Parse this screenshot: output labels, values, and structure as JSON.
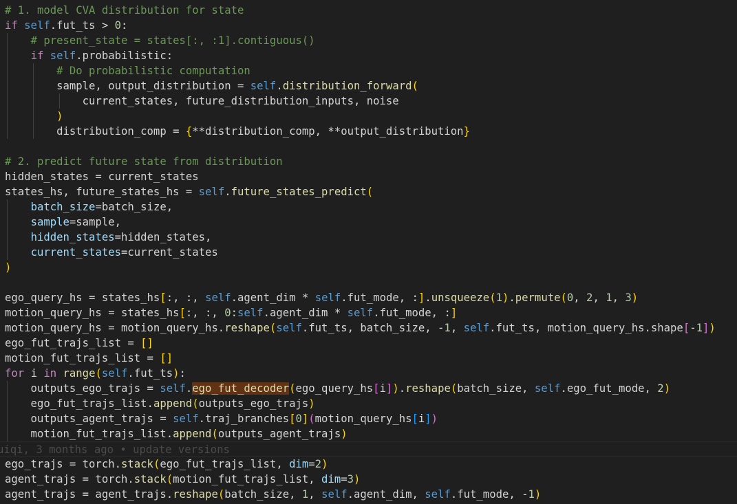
{
  "blame": "uiqi, 3 months ago • update versions",
  "lines": [
    [
      [
        "c",
        "# 1. model CVA distribution for state"
      ]
    ],
    [
      [
        "k",
        "if "
      ],
      [
        "s",
        "self"
      ],
      [
        "v",
        ".fut_ts > "
      ],
      [
        "n",
        "0"
      ],
      [
        "v",
        ":"
      ]
    ],
    [
      [
        "v",
        "    "
      ],
      [
        "c",
        "# present_state = states[:, :1].contiguous()"
      ]
    ],
    [
      [
        "v",
        "    "
      ],
      [
        "k",
        "if "
      ],
      [
        "s",
        "self"
      ],
      [
        "v",
        ".probabilistic:"
      ]
    ],
    [
      [
        "v",
        "        "
      ],
      [
        "c",
        "# Do probabilistic computation"
      ]
    ],
    [
      [
        "v",
        "        sample, output_distribution = "
      ],
      [
        "s",
        "self"
      ],
      [
        "v",
        "."
      ],
      [
        "f",
        "distribution_forward"
      ],
      [
        "b",
        "("
      ]
    ],
    [
      [
        "v",
        "            current_states, future_distribution_inputs, noise"
      ]
    ],
    [
      [
        "v",
        "        "
      ],
      [
        "b",
        ")"
      ]
    ],
    [
      [
        "v",
        "        distribution_comp = "
      ],
      [
        "b",
        "{"
      ],
      [
        "v",
        "**distribution_comp, **output_distribution"
      ],
      [
        "b",
        "}"
      ]
    ],
    [],
    [
      [
        "c",
        "# 2. predict future state from distribution"
      ]
    ],
    [
      [
        "v",
        "hidden_states = current_states"
      ]
    ],
    [
      [
        "v",
        "states_hs, future_states_hs = "
      ],
      [
        "s",
        "self"
      ],
      [
        "v",
        "."
      ],
      [
        "f",
        "future_states_predict"
      ],
      [
        "b",
        "("
      ]
    ],
    [
      [
        "v",
        "    "
      ],
      [
        "p",
        "batch_size"
      ],
      [
        "v",
        "=batch_size,"
      ]
    ],
    [
      [
        "v",
        "    "
      ],
      [
        "p",
        "sample"
      ],
      [
        "v",
        "=sample,"
      ]
    ],
    [
      [
        "v",
        "    "
      ],
      [
        "p",
        "hidden_states"
      ],
      [
        "v",
        "=hidden_states,"
      ]
    ],
    [
      [
        "v",
        "    "
      ],
      [
        "p",
        "current_states"
      ],
      [
        "v",
        "=current_states"
      ]
    ],
    [
      [
        "b",
        ")"
      ]
    ],
    [],
    [
      [
        "v",
        "ego_query_hs = states_hs"
      ],
      [
        "b",
        "["
      ],
      [
        "v",
        ":, :, "
      ],
      [
        "s",
        "self"
      ],
      [
        "v",
        ".agent_dim * "
      ],
      [
        "s",
        "self"
      ],
      [
        "v",
        ".fut_mode, :"
      ],
      [
        "b",
        "]"
      ],
      [
        "v",
        "."
      ],
      [
        "f",
        "unsqueeze"
      ],
      [
        "b",
        "("
      ],
      [
        "n",
        "1"
      ],
      [
        "b",
        ")"
      ],
      [
        "v",
        "."
      ],
      [
        "f",
        "permute"
      ],
      [
        "b",
        "("
      ],
      [
        "n",
        "0"
      ],
      [
        "v",
        ", "
      ],
      [
        "n",
        "2"
      ],
      [
        "v",
        ", "
      ],
      [
        "n",
        "1"
      ],
      [
        "v",
        ", "
      ],
      [
        "n",
        "3"
      ],
      [
        "b",
        ")"
      ]
    ],
    [
      [
        "v",
        "motion_query_hs = states_hs"
      ],
      [
        "b",
        "["
      ],
      [
        "v",
        ":, :, "
      ],
      [
        "n",
        "0"
      ],
      [
        "v",
        ":"
      ],
      [
        "s",
        "self"
      ],
      [
        "v",
        ".agent_dim * "
      ],
      [
        "s",
        "self"
      ],
      [
        "v",
        ".fut_mode, :"
      ],
      [
        "b",
        "]"
      ]
    ],
    [
      [
        "v",
        "motion_query_hs = motion_query_hs."
      ],
      [
        "f",
        "reshape"
      ],
      [
        "b",
        "("
      ],
      [
        "s",
        "self"
      ],
      [
        "v",
        ".fut_ts, batch_size, -"
      ],
      [
        "n",
        "1"
      ],
      [
        "v",
        ", "
      ],
      [
        "s",
        "self"
      ],
      [
        "v",
        ".fut_ts, motion_query_hs.shape"
      ],
      [
        "b2",
        "["
      ],
      [
        "v",
        "-"
      ],
      [
        "n",
        "1"
      ],
      [
        "b2",
        "]"
      ],
      [
        "b",
        ")"
      ]
    ],
    [
      [
        "v",
        "ego_fut_trajs_list = "
      ],
      [
        "b",
        "[]"
      ]
    ],
    [
      [
        "v",
        "motion_fut_trajs_list = "
      ],
      [
        "b",
        "[]"
      ]
    ],
    [
      [
        "k",
        "for "
      ],
      [
        "v",
        "i "
      ],
      [
        "k",
        "in "
      ],
      [
        "f",
        "range"
      ],
      [
        "b",
        "("
      ],
      [
        "s",
        "self"
      ],
      [
        "v",
        ".fut_ts"
      ],
      [
        "b",
        ")"
      ],
      [
        "v",
        ":"
      ]
    ],
    [
      [
        "v",
        "    outputs_ego_trajs = "
      ],
      [
        "s",
        "self"
      ],
      [
        "v",
        "."
      ],
      [
        "hl",
        "ego_fut_decoder"
      ],
      [
        "b",
        "("
      ],
      [
        "v",
        "ego_query_hs"
      ],
      [
        "b2",
        "["
      ],
      [
        "v",
        "i"
      ],
      [
        "b2",
        "]"
      ],
      [
        "b",
        ")"
      ],
      [
        "v",
        "."
      ],
      [
        "f",
        "reshape"
      ],
      [
        "b",
        "("
      ],
      [
        "v",
        "batch_size, "
      ],
      [
        "s",
        "self"
      ],
      [
        "v",
        ".ego_fut_mode, "
      ],
      [
        "n",
        "2"
      ],
      [
        "b",
        ")"
      ]
    ],
    [
      [
        "v",
        "    ego_fut_trajs_list."
      ],
      [
        "f",
        "append"
      ],
      [
        "b",
        "("
      ],
      [
        "v",
        "outputs_ego_trajs"
      ],
      [
        "b",
        ")"
      ]
    ],
    [
      [
        "v",
        "    outputs_agent_trajs = "
      ],
      [
        "s",
        "self"
      ],
      [
        "v",
        ".traj_branches"
      ],
      [
        "b",
        "["
      ],
      [
        "n",
        "0"
      ],
      [
        "b",
        "]"
      ],
      [
        "b2",
        "("
      ],
      [
        "v",
        "motion_query_hs"
      ],
      [
        "b3",
        "["
      ],
      [
        "v",
        "i"
      ],
      [
        "b3",
        "]"
      ],
      [
        "b2",
        ")"
      ]
    ],
    [
      [
        "v",
        "    motion_fut_trajs_list."
      ],
      [
        "f",
        "append"
      ],
      [
        "b",
        "("
      ],
      [
        "v",
        "outputs_agent_trajs"
      ],
      [
        "b",
        ")"
      ]
    ],
    [
      [
        "v",
        "ego_trajs = torch."
      ],
      [
        "f",
        "stack"
      ],
      [
        "b",
        "("
      ],
      [
        "v",
        "ego_fut_trajs_list, "
      ],
      [
        "p",
        "dim"
      ],
      [
        "v",
        "="
      ],
      [
        "n",
        "2"
      ],
      [
        "b",
        ")"
      ]
    ],
    [
      [
        "v",
        "agent_trajs = torch."
      ],
      [
        "f",
        "stack"
      ],
      [
        "b",
        "("
      ],
      [
        "v",
        "motion_fut_trajs_list, "
      ],
      [
        "p",
        "dim"
      ],
      [
        "v",
        "="
      ],
      [
        "n",
        "3"
      ],
      [
        "b",
        ")"
      ]
    ],
    [
      [
        "v",
        "agent_trajs = agent_trajs."
      ],
      [
        "f",
        "reshape"
      ],
      [
        "b",
        "("
      ],
      [
        "v",
        "batch_size, "
      ],
      [
        "n",
        "1"
      ],
      [
        "v",
        ", "
      ],
      [
        "s",
        "self"
      ],
      [
        "v",
        ".agent_dim, "
      ],
      [
        "s",
        "self"
      ],
      [
        "v",
        ".fut_mode, -"
      ],
      [
        "n",
        "1"
      ],
      [
        "b",
        ")"
      ]
    ]
  ]
}
